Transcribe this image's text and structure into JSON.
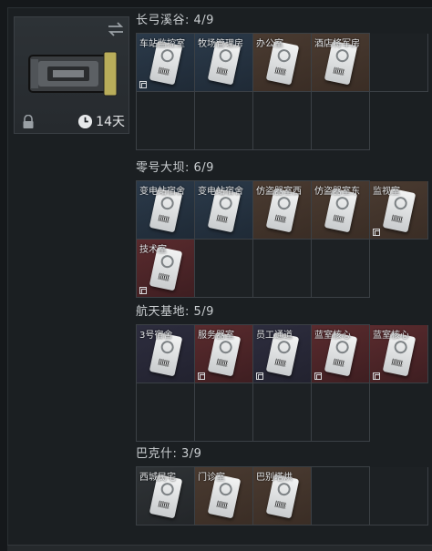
{
  "container": {
    "timer_text": "14天",
    "icons": [
      "swap-icon",
      "lock-icon",
      "clock-icon"
    ]
  },
  "sections": [
    {
      "title": "长弓溪谷: 4/9",
      "items": [
        {
          "label": "车站监控室",
          "color": "blue",
          "badge": true
        },
        {
          "label": "牧场管理房",
          "color": "blue",
          "badge": false
        },
        {
          "label": "办公室",
          "color": "brown",
          "badge": false
        },
        {
          "label": "酒店将军房",
          "color": "brown",
          "badge": false
        }
      ]
    },
    {
      "title": "零号大坝: 6/9",
      "items": [
        {
          "label": "变电站宿舍",
          "color": "blue",
          "badge": false
        },
        {
          "label": "变电站宿舍",
          "color": "blue",
          "badge": false
        },
        {
          "label": "仿盗器室西",
          "color": "brown",
          "badge": false
        },
        {
          "label": "仿盗器室东",
          "color": "brown",
          "badge": false
        },
        {
          "label": "监视室",
          "color": "brown",
          "badge": true
        },
        {
          "label": "技术室",
          "color": "red",
          "badge": true
        }
      ]
    },
    {
      "title": "航天基地: 5/9",
      "items": [
        {
          "label": "3号宿舍",
          "color": "dark",
          "badge": false
        },
        {
          "label": "服务器室",
          "color": "red",
          "badge": true
        },
        {
          "label": "员工通道",
          "color": "dark",
          "badge": true
        },
        {
          "label": "蓝室核心",
          "color": "red",
          "badge": true
        },
        {
          "label": "蓝室核心",
          "color": "red",
          "badge": true
        }
      ]
    },
    {
      "title": "巴克什: 3/9",
      "items": [
        {
          "label": "西城民宅",
          "color": "gray",
          "badge": false
        },
        {
          "label": "门诊室",
          "color": "brown",
          "badge": false
        },
        {
          "label": "巴别塔烘",
          "color": "brown",
          "badge": false
        }
      ]
    }
  ]
}
